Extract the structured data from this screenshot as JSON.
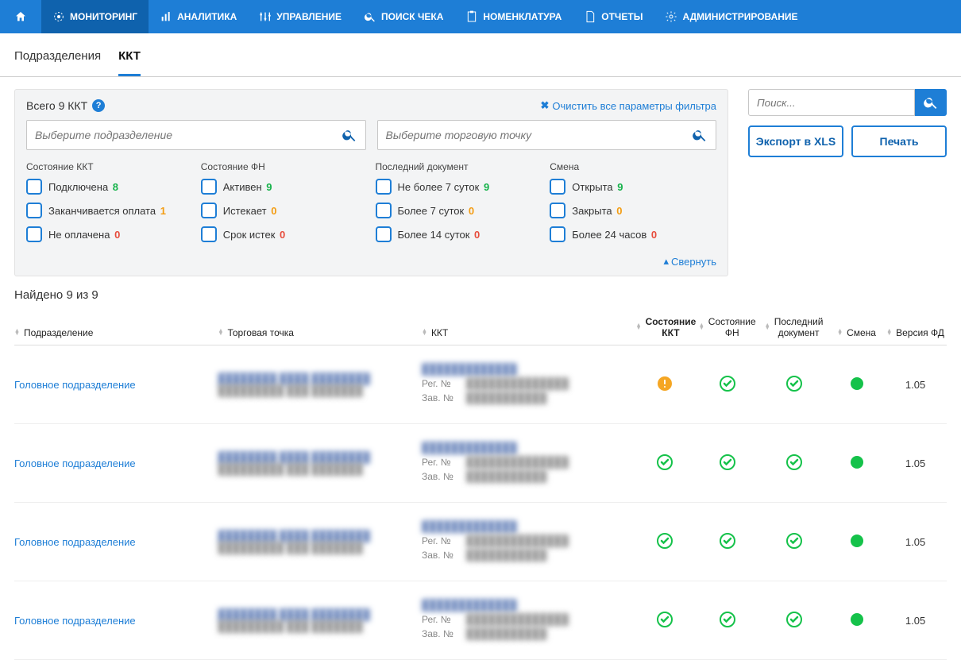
{
  "nav": {
    "items": [
      {
        "label": "МОНИТОРИНГ",
        "active": true
      },
      {
        "label": "АНАЛИТИКА"
      },
      {
        "label": "УПРАВЛЕНИЕ"
      },
      {
        "label": "ПОИСК ЧЕКА"
      },
      {
        "label": "НОМЕНКЛАТУРА"
      },
      {
        "label": "ОТЧЕТЫ"
      },
      {
        "label": "АДМИНИСТРИРОВАНИЕ"
      }
    ]
  },
  "subtabs": {
    "items": [
      {
        "label": "Подразделения"
      },
      {
        "label": "ККТ",
        "active": true
      }
    ]
  },
  "filter": {
    "total_label": "Всего 9 ККТ",
    "clear_label": "Очистить все параметры фильтра",
    "sel1_placeholder": "Выберите подразделение",
    "sel2_placeholder": "Выберите торговую точку",
    "collapse_label": "Свернуть",
    "cols": [
      {
        "title": "Состояние ККТ",
        "items": [
          {
            "label": "Подключена",
            "count": "8",
            "cls": "cnt-g"
          },
          {
            "label": "Заканчивается оплата",
            "count": "1",
            "cls": "cnt-o"
          },
          {
            "label": "Не оплачена",
            "count": "0",
            "cls": "cnt-r"
          }
        ]
      },
      {
        "title": "Состояние ФН",
        "items": [
          {
            "label": "Активен",
            "count": "9",
            "cls": "cnt-g"
          },
          {
            "label": "Истекает",
            "count": "0",
            "cls": "cnt-o"
          },
          {
            "label": "Срок истек",
            "count": "0",
            "cls": "cnt-r"
          }
        ]
      },
      {
        "title": "Последний документ",
        "items": [
          {
            "label": "Не более 7 суток",
            "count": "9",
            "cls": "cnt-g"
          },
          {
            "label": "Более 7 суток",
            "count": "0",
            "cls": "cnt-o"
          },
          {
            "label": "Более 14 суток",
            "count": "0",
            "cls": "cnt-r"
          }
        ]
      },
      {
        "title": "Смена",
        "items": [
          {
            "label": "Открыта",
            "count": "9",
            "cls": "cnt-g"
          },
          {
            "label": "Закрыта",
            "count": "0",
            "cls": "cnt-o"
          },
          {
            "label": "Более 24 часов",
            "count": "0",
            "cls": "cnt-r"
          }
        ]
      }
    ]
  },
  "side": {
    "search_placeholder": "Поиск...",
    "export_label": "Экспорт в XLS",
    "print_label": "Печать"
  },
  "results": {
    "found_label": "Найдено 9 из 9",
    "headers": {
      "sub": "Подразделение",
      "tp": "Торговая точка",
      "kkt": "ККТ",
      "st1": "Состояние",
      "st2": "ККТ",
      "fn1": "Состояние",
      "fn2": "ФН",
      "doc1": "Последний",
      "doc2": "документ",
      "sm": "Смена",
      "ver": "Версия ФД"
    },
    "reg_label": "Рег. №",
    "zav_label": "Зав. №",
    "rows": [
      {
        "sub": "Головное подразделение",
        "warn": true,
        "ver": "1.05"
      },
      {
        "sub": "Головное подразделение",
        "warn": false,
        "ver": "1.05"
      },
      {
        "sub": "Головное подразделение",
        "warn": false,
        "ver": "1.05"
      },
      {
        "sub": "Головное подразделение",
        "warn": false,
        "ver": "1.05"
      }
    ]
  }
}
